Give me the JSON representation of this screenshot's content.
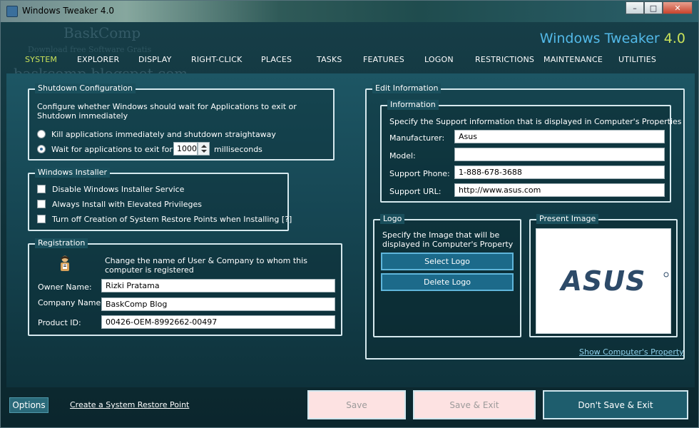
{
  "window": {
    "title": "Windows Tweaker 4.0"
  },
  "brand": {
    "name": "Windows Tweaker",
    "version": "4.0"
  },
  "watermark": {
    "line1": "BaskComp",
    "line2": "baskcomp.blogspot.com",
    "line3": "Download free Software Gratis"
  },
  "nav": {
    "tabs": [
      "SYSTEM",
      "EXPLORER",
      "DISPLAY",
      "RIGHT-CLICK",
      "PLACES",
      "TASKS",
      "FEATURES",
      "LOGON",
      "RESTRICTIONS",
      "MAINTENANCE",
      "UTILITIES"
    ],
    "active": "SYSTEM"
  },
  "shutdown": {
    "legend": "Shutdown Configuration",
    "description": "Configure whether Windows should wait for Applications to exit or Shutdown immediately",
    "option_kill": "Kill applications immediately and shutdown straightaway",
    "option_wait": "Wait for applications to exit for",
    "wait_value": "1000",
    "wait_unit": "milliseconds",
    "selected": "wait"
  },
  "installer": {
    "legend": "Windows Installer",
    "options": [
      "Disable Windows Installer Service",
      "Always Install with Elevated Privileges",
      "Turn off Creation of System Restore Points when Installing [?]"
    ]
  },
  "registration": {
    "legend": "Registration",
    "description": "Change the name of User & Company to whom this computer is registered",
    "owner_label": "Owner Name:",
    "owner_value": "Rizki Pratama",
    "company_label": "Company Name:",
    "company_value": "BaskComp Blog",
    "product_label": "Product ID:",
    "product_value": "00426-OEM-8992662-00497"
  },
  "edit_info": {
    "legend": "Edit Information",
    "information": {
      "legend": "Information",
      "description": "Specify the Support information that is displayed in Computer's Properties",
      "manufacturer_label": "Manufacturer:",
      "manufacturer_value": "Asus",
      "model_label": "Model:",
      "model_value": "",
      "phone_label": "Support Phone:",
      "phone_value": "1-888-678-3688",
      "url_label": "Support URL:",
      "url_value": "http://www.asus.com"
    },
    "logo": {
      "legend": "Logo",
      "description": "Specify the Image that will be displayed in Computer's Property",
      "select_label": "Select Logo",
      "delete_label": "Delete Logo"
    },
    "present_image": {
      "legend": "Present Image",
      "logo_text": "ASUS"
    },
    "show_link": "Show Computer's Property"
  },
  "footer": {
    "options_label": "Options",
    "restore_link": "Create a System Restore Point",
    "save_label": "Save",
    "save_exit_label": "Save & Exit",
    "dont_save_label": "Don't Save & Exit"
  },
  "colors": {
    "accent_green": "#c9e25a",
    "brand_blue": "#53b9e8",
    "link_blue": "#8fd0ea",
    "disabled_button_bg": "#fde2e2"
  }
}
